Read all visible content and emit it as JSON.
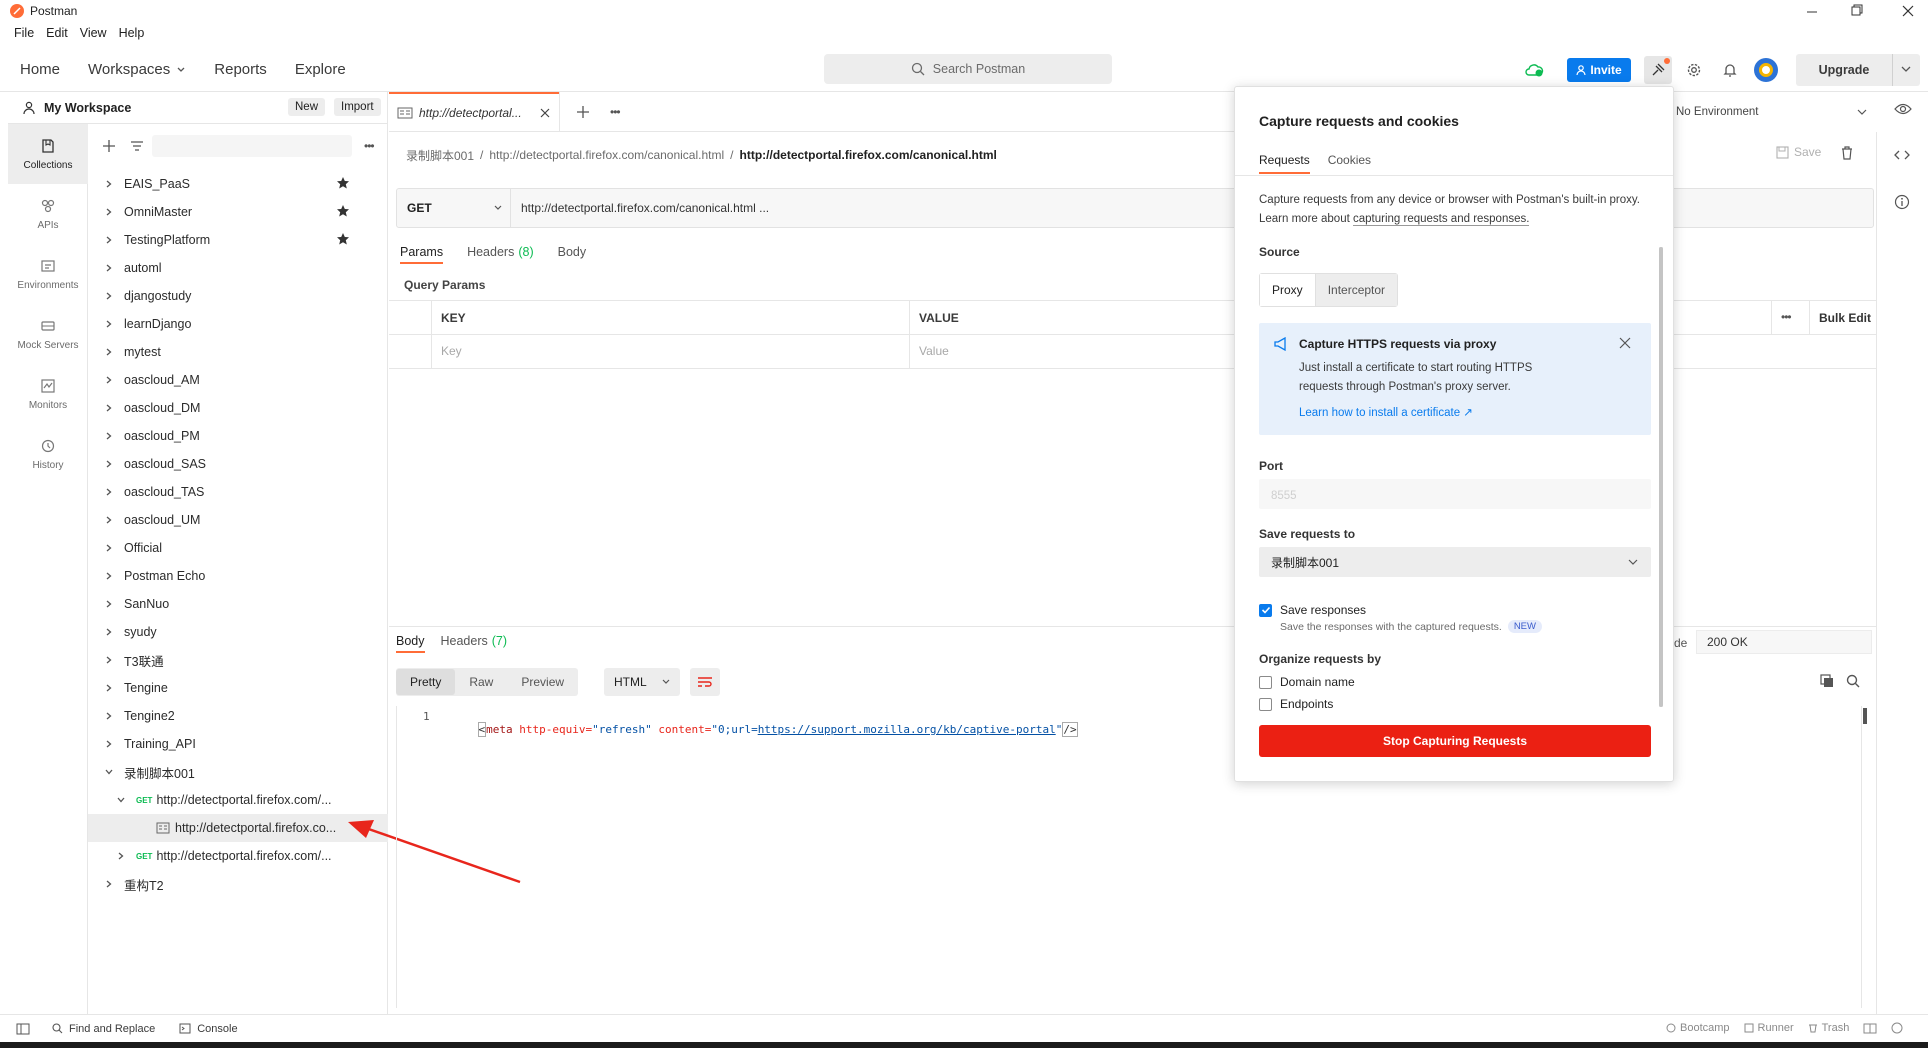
{
  "window": {
    "title": "Postman",
    "minimize": "—",
    "close": "✕"
  },
  "menu": [
    "File",
    "Edit",
    "View",
    "Help"
  ],
  "nav": {
    "home": "Home",
    "workspaces": "Workspaces",
    "reports": "Reports",
    "explore": "Explore",
    "search_placeholder": "Search Postman",
    "invite": "Invite",
    "upgrade": "Upgrade"
  },
  "rail": [
    {
      "label": "Collections",
      "icon": "collections-icon"
    },
    {
      "label": "APIs",
      "icon": "apis-icon"
    },
    {
      "label": "Environments",
      "icon": "environments-icon"
    },
    {
      "label": "Mock Servers",
      "icon": "mock-servers-icon"
    },
    {
      "label": "Monitors",
      "icon": "monitors-icon"
    },
    {
      "label": "History",
      "icon": "history-icon"
    }
  ],
  "sidebar": {
    "workspace": "My Workspace",
    "new_btn": "New",
    "import_btn": "Import",
    "collections": [
      {
        "name": "EAIS_PaaS",
        "starred": true
      },
      {
        "name": "OmniMaster",
        "starred": true
      },
      {
        "name": "TestingPlatform",
        "starred": true
      },
      {
        "name": "automl",
        "starred": false
      },
      {
        "name": "djangostudy",
        "starred": false
      },
      {
        "name": "learnDjango",
        "starred": false
      },
      {
        "name": "mytest",
        "starred": false
      },
      {
        "name": "oascloud_AM",
        "starred": false
      },
      {
        "name": "oascloud_DM",
        "starred": false
      },
      {
        "name": "oascloud_PM",
        "starred": false
      },
      {
        "name": "oascloud_SAS",
        "starred": false
      },
      {
        "name": "oascloud_TAS",
        "starred": false
      },
      {
        "name": "oascloud_UM",
        "starred": false
      },
      {
        "name": "Official",
        "starred": false
      },
      {
        "name": "Postman Echo",
        "starred": false
      },
      {
        "name": "SanNuo",
        "starred": false
      },
      {
        "name": "syudy",
        "starred": false
      },
      {
        "name": "T3联通",
        "starred": false
      },
      {
        "name": "Tengine",
        "starred": false
      },
      {
        "name": "Tengine2",
        "starred": false
      },
      {
        "name": "Training_API",
        "starred": false
      }
    ],
    "open_collection": "录制脚本001",
    "request1_method": "GET",
    "request1": "http://detectportal.firefox.com/...",
    "example": "http://detectportal.firefox.co...",
    "request2_method": "GET",
    "request2": "http://detectportal.firefox.com/...",
    "last_collection": "重构T2"
  },
  "tab": {
    "title": "http://detectportal..."
  },
  "breadcrumb": {
    "collection": "录制脚本001",
    "request": "http://detectportal.firefox.com/canonical.html",
    "current": "http://detectportal.firefox.com/canonical.html",
    "save": "Save",
    "env": "No Environment"
  },
  "request": {
    "method": "GET",
    "url": "http://detectportal.firefox.com/canonical.html ...",
    "tabs": {
      "params": "Params",
      "headers": "Headers",
      "headers_count": "(8)",
      "body": "Body"
    },
    "query_params": "Query Params",
    "key_header": "KEY",
    "value_header": "VALUE",
    "key_placeholder": "Key",
    "value_placeholder": "Value",
    "bulk_edit": "Bulk Edit"
  },
  "response": {
    "tabs": {
      "body": "Body",
      "headers": "Headers",
      "headers_count": "(7)"
    },
    "status_label": "de",
    "status": "200 OK",
    "views": [
      "Pretty",
      "Raw",
      "Preview"
    ],
    "format": "HTML",
    "line_no": "1",
    "code": {
      "open": "<",
      "tag": "meta",
      "attr1": " http-equiv=",
      "val1": "\"refresh\"",
      "attr2": " content=",
      "val2a": "\"0;url=",
      "val2link": "https://support.mozilla.org/kb/captive-portal",
      "val2b": "\"",
      "close": "/>"
    }
  },
  "popover": {
    "title": "Capture requests and cookies",
    "tab_requests": "Requests",
    "tab_cookies": "Cookies",
    "intro": "Capture requests from any device or browser with Postman's built-in proxy. Learn more about",
    "intro_link": "capturing requests and responses.",
    "source_label": "Source",
    "source_proxy": "Proxy",
    "source_interceptor": "Interceptor",
    "info_title": "Capture HTTPS requests via proxy",
    "info_body": "Just install a certificate to start routing HTTPS requests through Postman's proxy server.",
    "info_link": "Learn how to install a certificate ↗",
    "port_label": "Port",
    "port_value": "8555",
    "save_to_label": "Save requests to",
    "save_to_value": "录制脚本001",
    "save_responses": "Save responses",
    "save_responses_sub": "Save the responses with the captured requests.",
    "new_badge": "NEW",
    "organize_label": "Organize requests by",
    "org_domain": "Domain name",
    "org_endpoints": "Endpoints",
    "stop_btn": "Stop Capturing Requests"
  },
  "status": {
    "find": "Find and Replace",
    "console": "Console",
    "bootcamp": "Bootcamp",
    "runner": "Runner",
    "trash": "Trash"
  },
  "colors": {
    "accent": "#097bed",
    "danger": "#eb2013",
    "postman_orange": "#ff6c37"
  }
}
